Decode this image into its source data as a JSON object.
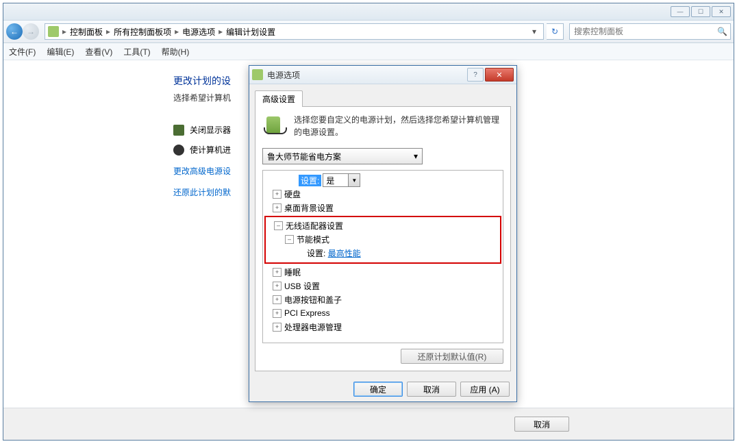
{
  "titlebar": {
    "min": "—",
    "max": "☐",
    "close": "✕"
  },
  "nav": {
    "back": "←",
    "fwd": "→"
  },
  "breadcrumb": [
    "控制面板",
    "所有控制面板项",
    "电源选项",
    "编辑计划设置"
  ],
  "search": {
    "placeholder": "搜索控制面板"
  },
  "menus": [
    "文件(F)",
    "编辑(E)",
    "查看(V)",
    "工具(T)",
    "帮助(H)"
  ],
  "page": {
    "title": "更改计划的设",
    "subtitle": "选择希望计算机",
    "rows": {
      "display_off": "关闭显示器",
      "sleep": "使计算机进"
    },
    "links": {
      "advanced": "更改高级电源设",
      "restore": "还原此计划的默"
    },
    "cancel_btn": "取消"
  },
  "dialog": {
    "title": "电源选项",
    "help": "?",
    "close": "✕",
    "tab": "高级设置",
    "intro": "选择您要自定义的电源计划，然后选择您希望计算机管理的电源设置。",
    "plan_selected": "鲁大师节能省电方案",
    "tree": {
      "setting_label": "设置:",
      "setting_value": "是",
      "items": {
        "hdd": "硬盘",
        "desktop_bg": "桌面背景设置",
        "wireless": "无线适配器设置",
        "power_mode": "节能模式",
        "power_mode_setting_label": "设置:",
        "power_mode_setting_value": "最高性能",
        "sleep": "睡眠",
        "usb": "USB 设置",
        "power_button": "电源按钮和盖子",
        "pci": "PCI Express",
        "cpu": "处理器电源管理"
      }
    },
    "restore_defaults": "还原计划默认值(R)",
    "ok": "确定",
    "cancel": "取消",
    "apply": "应用 (A)"
  }
}
